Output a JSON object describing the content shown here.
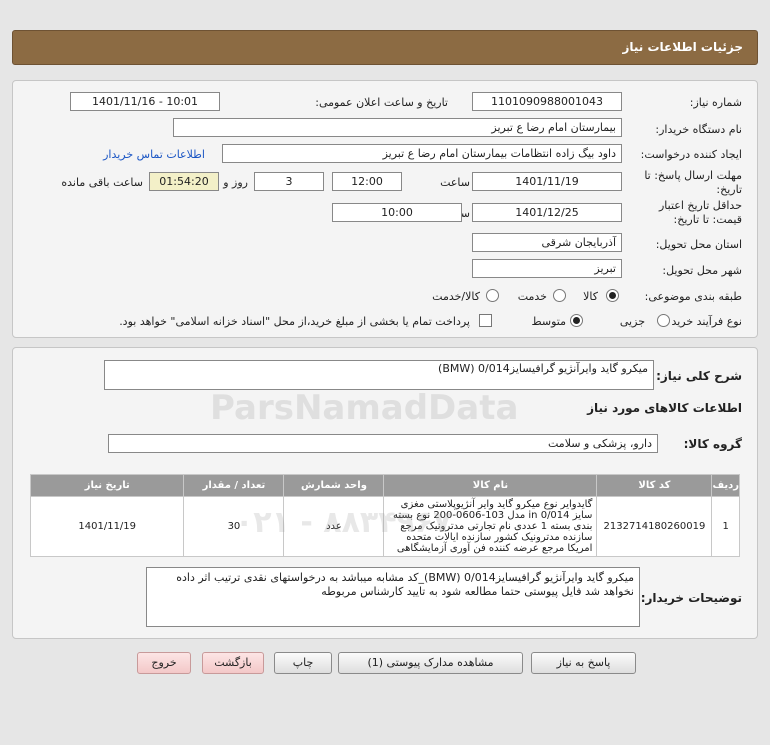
{
  "header": {
    "title": "جزئیات اطلاعات نیاز"
  },
  "form": {
    "need_number": {
      "label": "شماره نیاز:",
      "value": "1101090988001043"
    },
    "announce_datetime": {
      "label": "تاریخ و ساعت اعلان عمومی:",
      "value": "1401/11/16 - 10:01"
    },
    "buyer_org": {
      "label": "نام دستگاه خریدار:",
      "value": "بیمارستان امام رضا  ع  تبریز"
    },
    "requester": {
      "label": "ایجاد کننده درخواست:",
      "value": "داود بیگ زاده انتظامات بیمارستان امام رضا  ع  تبریز"
    },
    "contact_link": "اطلاعات تماس خریدار",
    "reply_deadline": {
      "label1": "مهلت ارسال پاسخ: تا",
      "label2": "تاریخ:",
      "date": "1401/11/19",
      "time_label": "ساعت",
      "time": "12:00",
      "days": "3",
      "days_label": "روز و",
      "remaining": "01:54:20",
      "remaining_label": "ساعت باقی مانده"
    },
    "price_validity": {
      "label1": "حداقل تاریخ اعتبار",
      "label2": "قیمت: تا تاریخ:",
      "date": "1401/12/25",
      "time_label": "ساعت",
      "time": "10:00"
    },
    "delivery_province": {
      "label": "استان محل تحویل:",
      "value": "آذربایجان شرقی"
    },
    "delivery_city": {
      "label": "شهر محل تحویل:",
      "value": "تبریز"
    },
    "category": {
      "label": "طبقه بندی موضوعی:",
      "options": [
        "کالا",
        "خدمت",
        "کالا/خدمت"
      ],
      "selected": "کالا"
    },
    "process_type": {
      "label": "نوع فرآیند خرید :",
      "options": [
        "جزیی",
        "متوسط"
      ],
      "selected": "متوسط",
      "checkbox_text": "پرداخت تمام یا بخشی از مبلغ خرید،از محل \"اسناد خزانه اسلامی\" خواهد بود."
    }
  },
  "summary": {
    "label": "شرح کلی نیاز:",
    "value": "میکرو گاید وایرآنژیو گرافیسایز0/014 (BMW)"
  },
  "goods_section": {
    "title": "اطلاعات کالاهای مورد نیاز",
    "group_label": "گروه کالا:",
    "group_value": "دارو، پزشکی و سلامت"
  },
  "table": {
    "headers": [
      "ردیف",
      "کد کالا",
      "نام کالا",
      "واحد شمارش",
      "تعداد / مقدار",
      "تاریخ نیاز"
    ],
    "rows": [
      {
        "index": "1",
        "code": "2132714180260019",
        "name": "گایدوایر نوع میکرو گاید وایر آنژیوپلاستی مغزی سایز in 0/014 مدل 103-0606-200 نوع بسته بندی بسته 1 عددی نام تجارتی مدترونیک مرجع سازنده مدترونیک کشور سازنده ایالات متحده امریکا مرجع عرضه کننده فن آوری آزمایشگاهی",
        "unit": "عدد",
        "qty": "30",
        "date": "1401/11/19"
      }
    ]
  },
  "buyer_notes": {
    "label": "توضیحات خریدار:",
    "value": "میکرو گاید وایرآنژیو گرافیسایز0/014 (BMW)_کد مشابه میباشد به درخواستهای نقدی ترتیب اثر داده نخواهد شد فایل پیوستی حتما مطالعه شود به تایید کارشناس مربوطه"
  },
  "buttons": {
    "reply": "پاسخ به نیاز",
    "attachments": "مشاهده مدارک پیوستی (1)",
    "print": "چاپ",
    "back": "بازگشت",
    "exit": "خروج"
  },
  "colors": {
    "header_bg": "#8c6b43",
    "link": "#1a55c4",
    "table_header": "#9a9a9a"
  }
}
